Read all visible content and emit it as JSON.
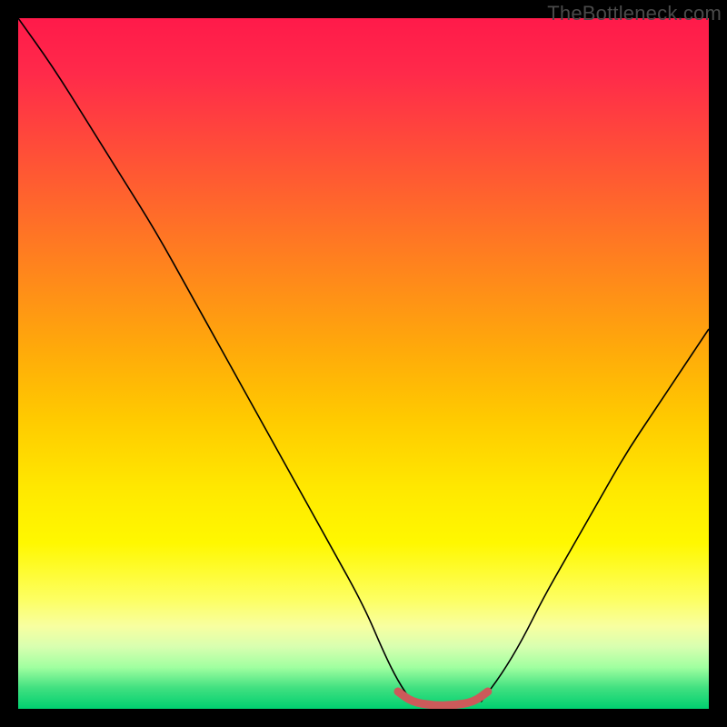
{
  "watermark": "TheBottleneck.com",
  "chart_data": {
    "type": "line",
    "title": "",
    "xlabel": "",
    "ylabel": "",
    "xlim": [
      0,
      100
    ],
    "ylim": [
      0,
      100
    ],
    "series": [
      {
        "name": "left-curve",
        "x": [
          0,
          5,
          10,
          15,
          20,
          25,
          30,
          35,
          40,
          45,
          50,
          53,
          55,
          57
        ],
        "values": [
          100,
          93,
          85,
          77,
          69,
          60,
          51,
          42,
          33,
          24,
          15,
          8,
          4,
          1
        ]
      },
      {
        "name": "right-curve",
        "x": [
          67,
          70,
          73,
          76,
          80,
          84,
          88,
          92,
          96,
          100
        ],
        "values": [
          1,
          5,
          10,
          16,
          23,
          30,
          37,
          43,
          49,
          55
        ]
      },
      {
        "name": "optimal-highlight",
        "x": [
          55,
          57,
          60,
          63,
          66,
          68
        ],
        "values": [
          2.5,
          1,
          0.5,
          0.5,
          1,
          2.5
        ]
      }
    ],
    "gradient_stops": [
      {
        "pct": 0,
        "color": "#ff1a4a"
      },
      {
        "pct": 28,
        "color": "#ff6a2a"
      },
      {
        "pct": 58,
        "color": "#ffca00"
      },
      {
        "pct": 84,
        "color": "#fdff60"
      },
      {
        "pct": 100,
        "color": "#00d070"
      }
    ]
  }
}
